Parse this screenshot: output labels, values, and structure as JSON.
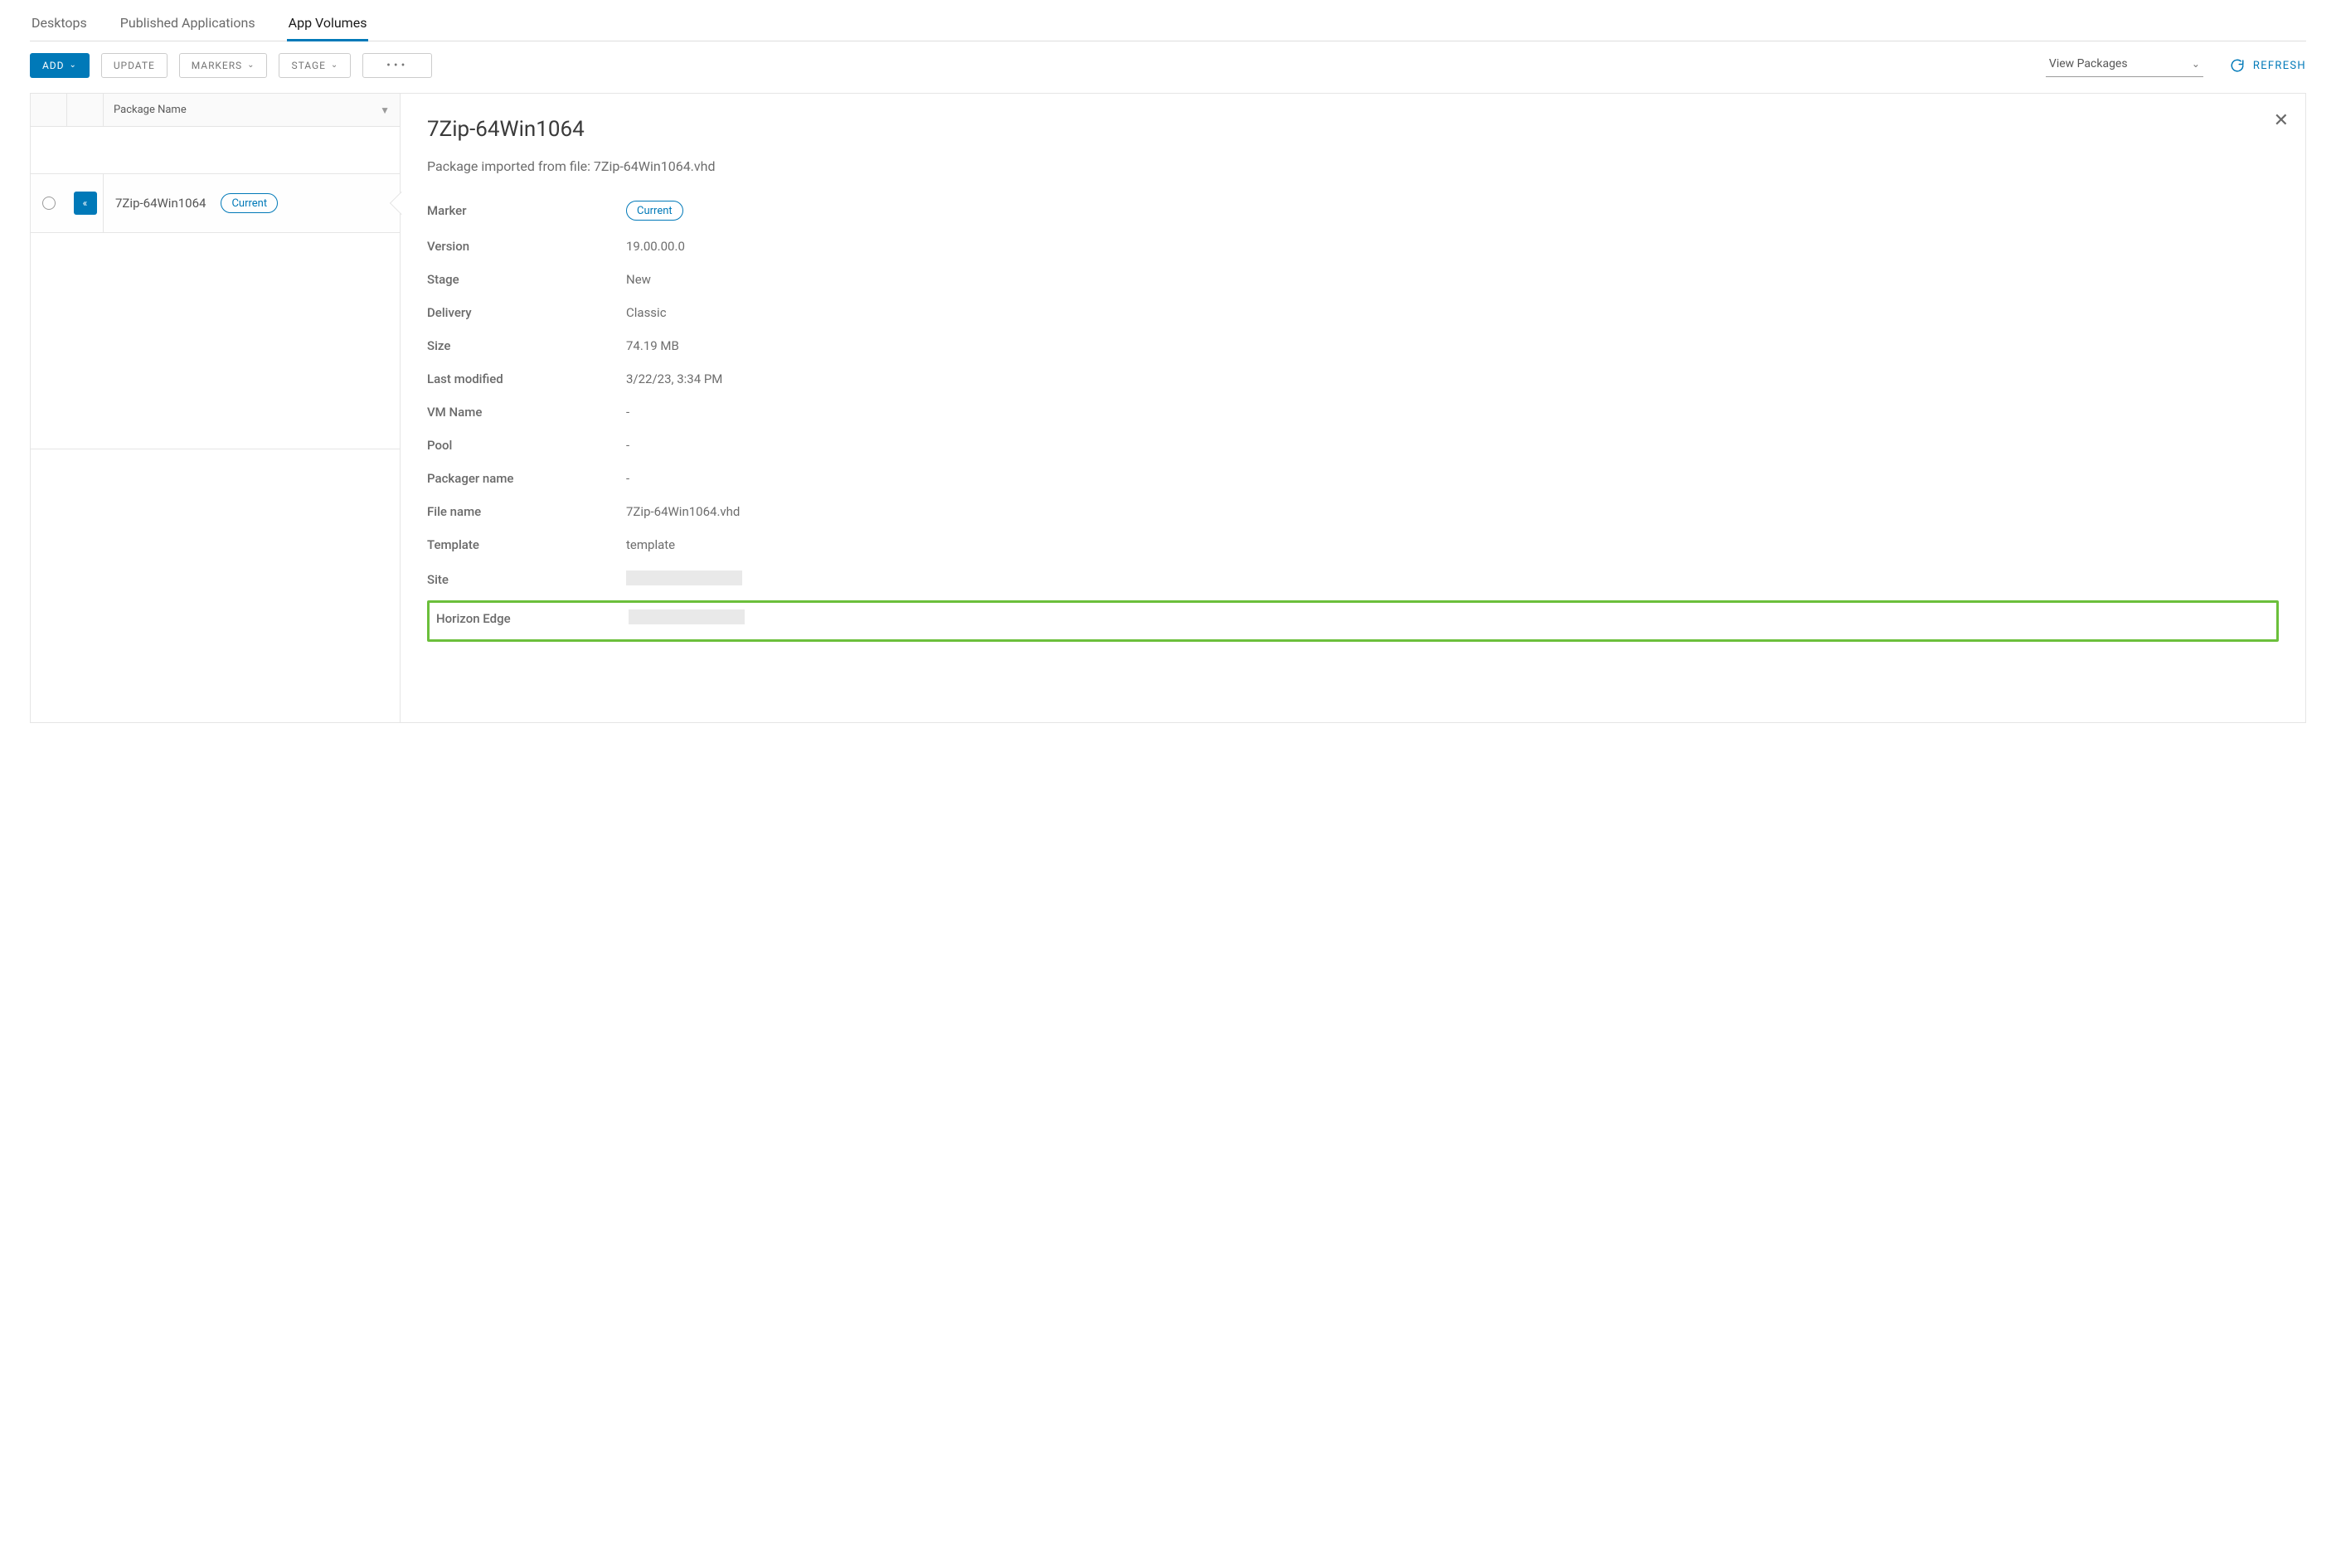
{
  "tabs": [
    {
      "label": "Desktops",
      "active": false
    },
    {
      "label": "Published Applications",
      "active": false
    },
    {
      "label": "App Volumes",
      "active": true
    }
  ],
  "toolbar": {
    "add_label": "ADD",
    "update_label": "UPDATE",
    "markers_label": "MARKERS",
    "stage_label": "STAGE",
    "view_select": "View Packages",
    "refresh_label": "REFRESH"
  },
  "list": {
    "header_label": "Package Name",
    "rows": [
      {
        "name": "7Zip-64Win1064",
        "marker": "Current",
        "selected": true
      }
    ]
  },
  "detail": {
    "title": "7Zip-64Win1064",
    "subtitle": "Package imported from file: 7Zip-64Win1064.vhd",
    "fields": {
      "marker_label": "Marker",
      "marker_value": "Current",
      "version_label": "Version",
      "version_value": "19.00.00.0",
      "stage_label": "Stage",
      "stage_value": "New",
      "delivery_label": "Delivery",
      "delivery_value": "Classic",
      "size_label": "Size",
      "size_value": "74.19 MB",
      "lastmod_label": "Last modified",
      "lastmod_value": "3/22/23, 3:34 PM",
      "vmname_label": "VM Name",
      "vmname_value": "-",
      "pool_label": "Pool",
      "pool_value": "-",
      "packager_label": "Packager name",
      "packager_value": "-",
      "filename_label": "File name",
      "filename_value": "7Zip-64Win1064.vhd",
      "template_label": "Template",
      "template_value": "template",
      "site_label": "Site",
      "horizon_label": "Horizon Edge"
    }
  }
}
